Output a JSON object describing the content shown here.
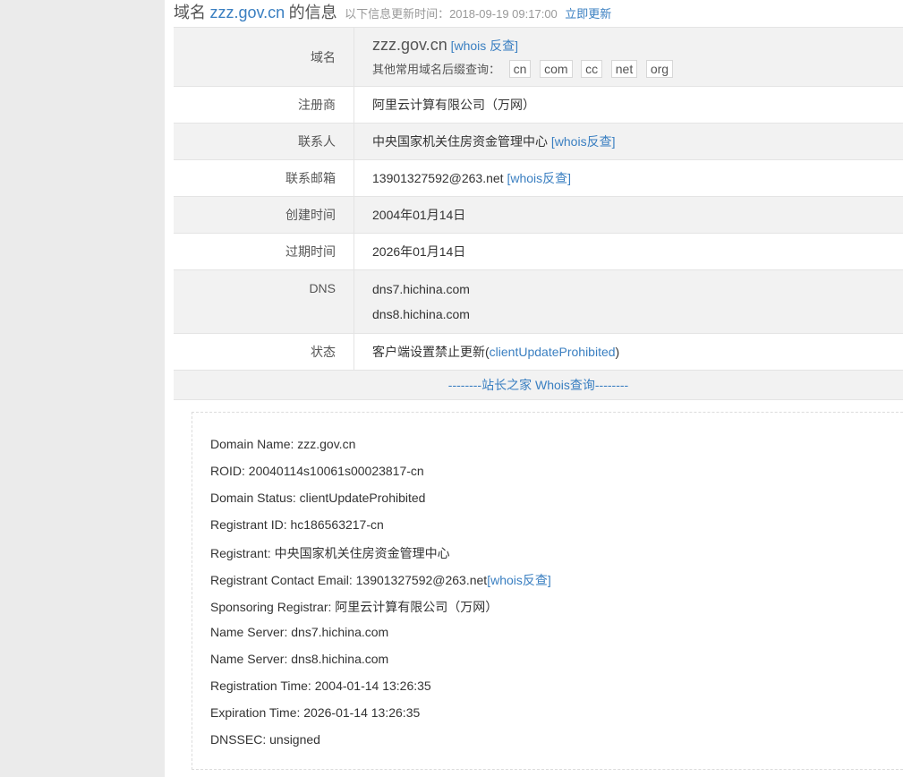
{
  "header": {
    "title_prefix": "域名",
    "domain": "zzz.gov.cn",
    "title_suffix": "的信息",
    "update_text": "以下信息更新时间：2018-09-19 09:17:00",
    "refresh_label": "立即更新"
  },
  "info": {
    "domain_label": "域名",
    "domain_value": "zzz.gov.cn",
    "domain_whois_link": "[whois 反查]",
    "suffix_label": "其他常用域名后缀查询：",
    "suffixes": [
      "cn",
      "com",
      "cc",
      "net",
      "org"
    ],
    "registrar_label": "注册商",
    "registrar_value": "阿里云计算有限公司（万网）",
    "contact_label": "联系人",
    "contact_value": "中央国家机关住房资金管理中心",
    "contact_whois_link": "[whois反查]",
    "email_label": "联系邮箱",
    "email_value": "13901327592@263.net",
    "email_whois_link": "[whois反查]",
    "created_label": "创建时间",
    "created_value": "2004年01月14日",
    "expire_label": "过期时间",
    "expire_value": "2026年01月14日",
    "dns_label": "DNS",
    "dns_values": [
      "dns7.hichina.com",
      "dns8.hichina.com"
    ],
    "status_label": "状态",
    "status_text": "客户端设置禁止更新(",
    "status_link": "clientUpdateProhibited",
    "status_close": ")",
    "separator_text": "--------站长之家 Whois查询--------"
  },
  "raw_whois": {
    "lines": [
      "Domain Name: zzz.gov.cn",
      "ROID: 20040114s10061s00023817-cn",
      "Domain Status: clientUpdateProhibited",
      "Registrant ID: hc186563217-cn",
      "Registrant: 中央国家机关住房资金管理中心",
      "Registrant Contact Email: 13901327592@263.net",
      "Sponsoring Registrar: 阿里云计算有限公司（万网）",
      "Name Server: dns7.hichina.com",
      "Name Server: dns8.hichina.com",
      "Registration Time: 2004-01-14 13:26:35",
      "Expiration Time: 2026-01-14 13:26:35",
      "DNSSEC: unsigned"
    ],
    "email_whois_link": "[whois反查]"
  }
}
